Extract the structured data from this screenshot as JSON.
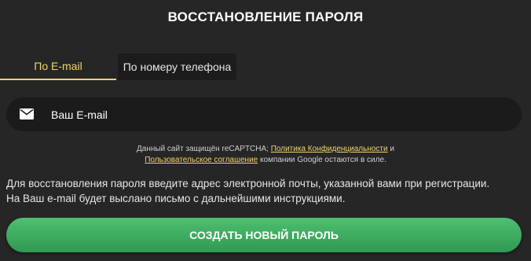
{
  "title": "ВОССТАНОВЛЕНИЕ ПАРОЛЯ",
  "tabs": [
    {
      "label": "По E-mail",
      "active": true
    },
    {
      "label": "По номеру телефона",
      "active": false
    }
  ],
  "email": {
    "placeholder": "Ваш E-mail",
    "value": "",
    "icon": "mail-icon"
  },
  "recaptcha": {
    "prefix": "Данный сайт защищён reCAPTCHA;",
    "privacy_link": "Политика Конфиденциальности",
    "and": "и",
    "terms_link": "Пользовательское соглашение",
    "suffix": "компании Google остаются в силе."
  },
  "info": {
    "line1": "Для восстановления пароля введите адрес электронной почты, указанной вами при регистрации.",
    "line2": "На Ваш e-mail будет выслано письмо с дальнейшими инструкциями."
  },
  "submit_label": "СОЗДАТЬ НОВЫЙ ПАРОЛЬ",
  "colors": {
    "background": "#262626",
    "accent": "#f0d36b",
    "button": "#3fae62",
    "field": "#1b1b1b"
  }
}
